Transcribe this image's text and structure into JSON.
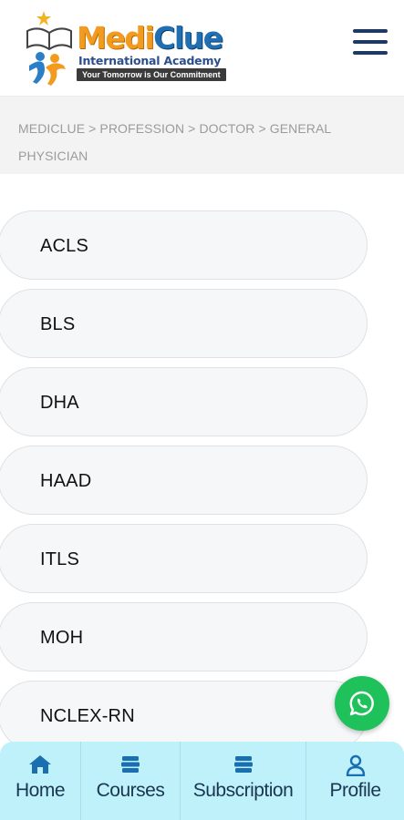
{
  "header": {
    "brand_title_medi": "Medi",
    "brand_title_clue": "Clue",
    "brand_subtitle": "International Academy",
    "brand_tagline": "Your Tomorrow is Our Commitment",
    "menu_icon": "hamburger-menu-icon"
  },
  "breadcrumb": {
    "text": "MEDICLUE > PROFESSION > DOCTOR > GENERAL PHYSICIAN"
  },
  "courses": [
    {
      "label": "ACLS"
    },
    {
      "label": "BLS"
    },
    {
      "label": "DHA"
    },
    {
      "label": "HAAD"
    },
    {
      "label": "ITLS"
    },
    {
      "label": "MOH"
    },
    {
      "label": "NCLEX-RN"
    }
  ],
  "whatsapp": {
    "icon": "whatsapp-icon",
    "color": "#1fc25a"
  },
  "bottom_nav": {
    "items": [
      {
        "label": "Home",
        "icon": "home-icon"
      },
      {
        "label": "Courses",
        "icon": "courses-icon"
      },
      {
        "label": "Subscription",
        "icon": "subscription-icon"
      },
      {
        "label": "Profile",
        "icon": "user-icon"
      }
    ]
  },
  "colors": {
    "brand_orange": "#f39b1e",
    "brand_blue": "#1f6fb2",
    "nav_background": "#bff1fb",
    "nav_icon": "#1a6fb0"
  }
}
